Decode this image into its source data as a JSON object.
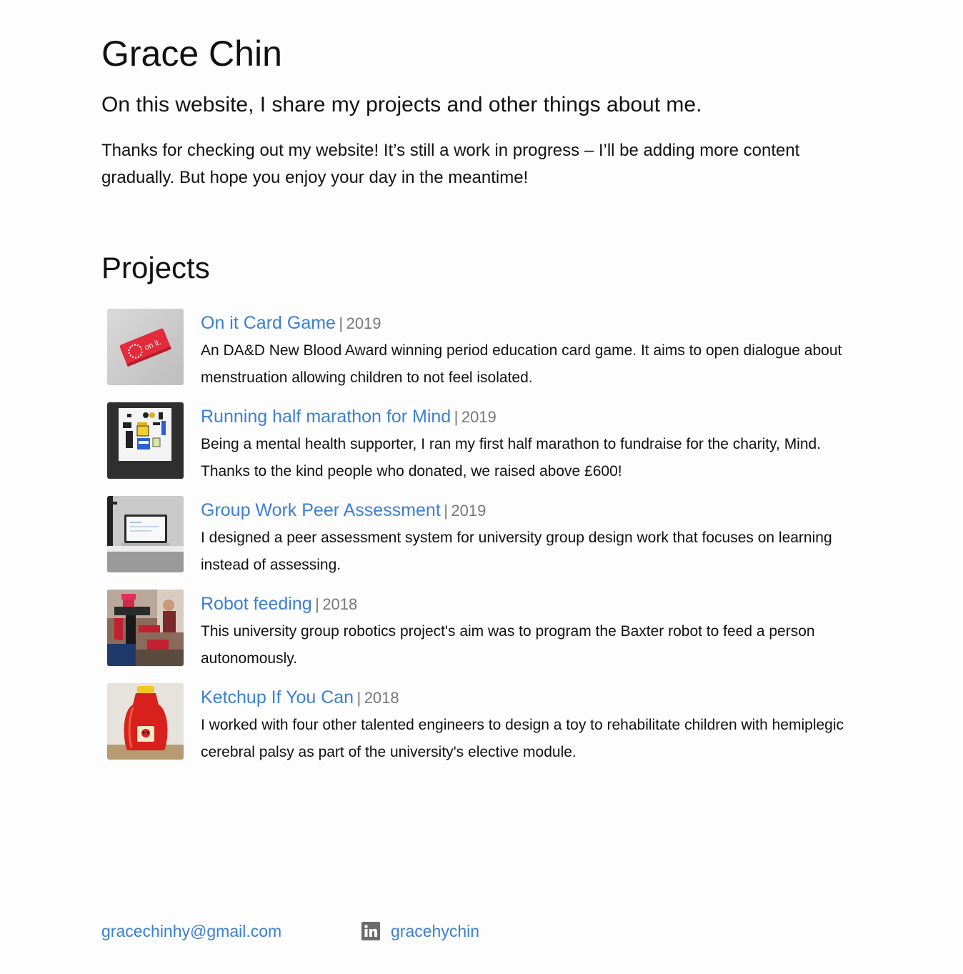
{
  "header": {
    "name": "Grace Chin",
    "tagline": "On this website, I share my projects and other things about me.",
    "intro": "Thanks for checking out my website! It’s still a work in progress – I’ll be adding more content gradually. But hope you enjoy your day in the meantime!"
  },
  "projects": {
    "heading": "Projects",
    "separator": "|",
    "items": [
      {
        "title": "On it Card Game",
        "year": "2019",
        "description": "An DA&D New Blood Award winning period education card game. It aims to open dialogue about menstruation allowing children to not feel isolated.",
        "thumbnail_logo_text": "on it."
      },
      {
        "title": "Running half marathon for Mind",
        "year": "2019",
        "description": "Being a mental health supporter, I ran my first half marathon to fundraise for the charity, Mind. Thanks to the kind people who donated, we raised above £600!"
      },
      {
        "title": "Group Work Peer Assessment",
        "year": "2019",
        "description": "I designed a peer assessment system for university group design work that focuses on learning instead of assessing."
      },
      {
        "title": "Robot feeding",
        "year": "2018",
        "description": "This university group robotics project's aim was to program the Baxter robot to feed a person autonomously."
      },
      {
        "title": "Ketchup If You Can",
        "year": "2018",
        "description": "I worked with four other talented engineers to design a toy to rehabilitate children with hemiplegic cerebral palsy as part of the university's elective module."
      }
    ]
  },
  "footer": {
    "email": "gracechinhy@gmail.com",
    "linkedin_handle": "gracehychin",
    "linkedin_icon": "linkedin-icon"
  },
  "colors": {
    "link": "#3b7fd4",
    "meta": "#777777",
    "text": "#111111",
    "background": "#fdfdfe"
  }
}
